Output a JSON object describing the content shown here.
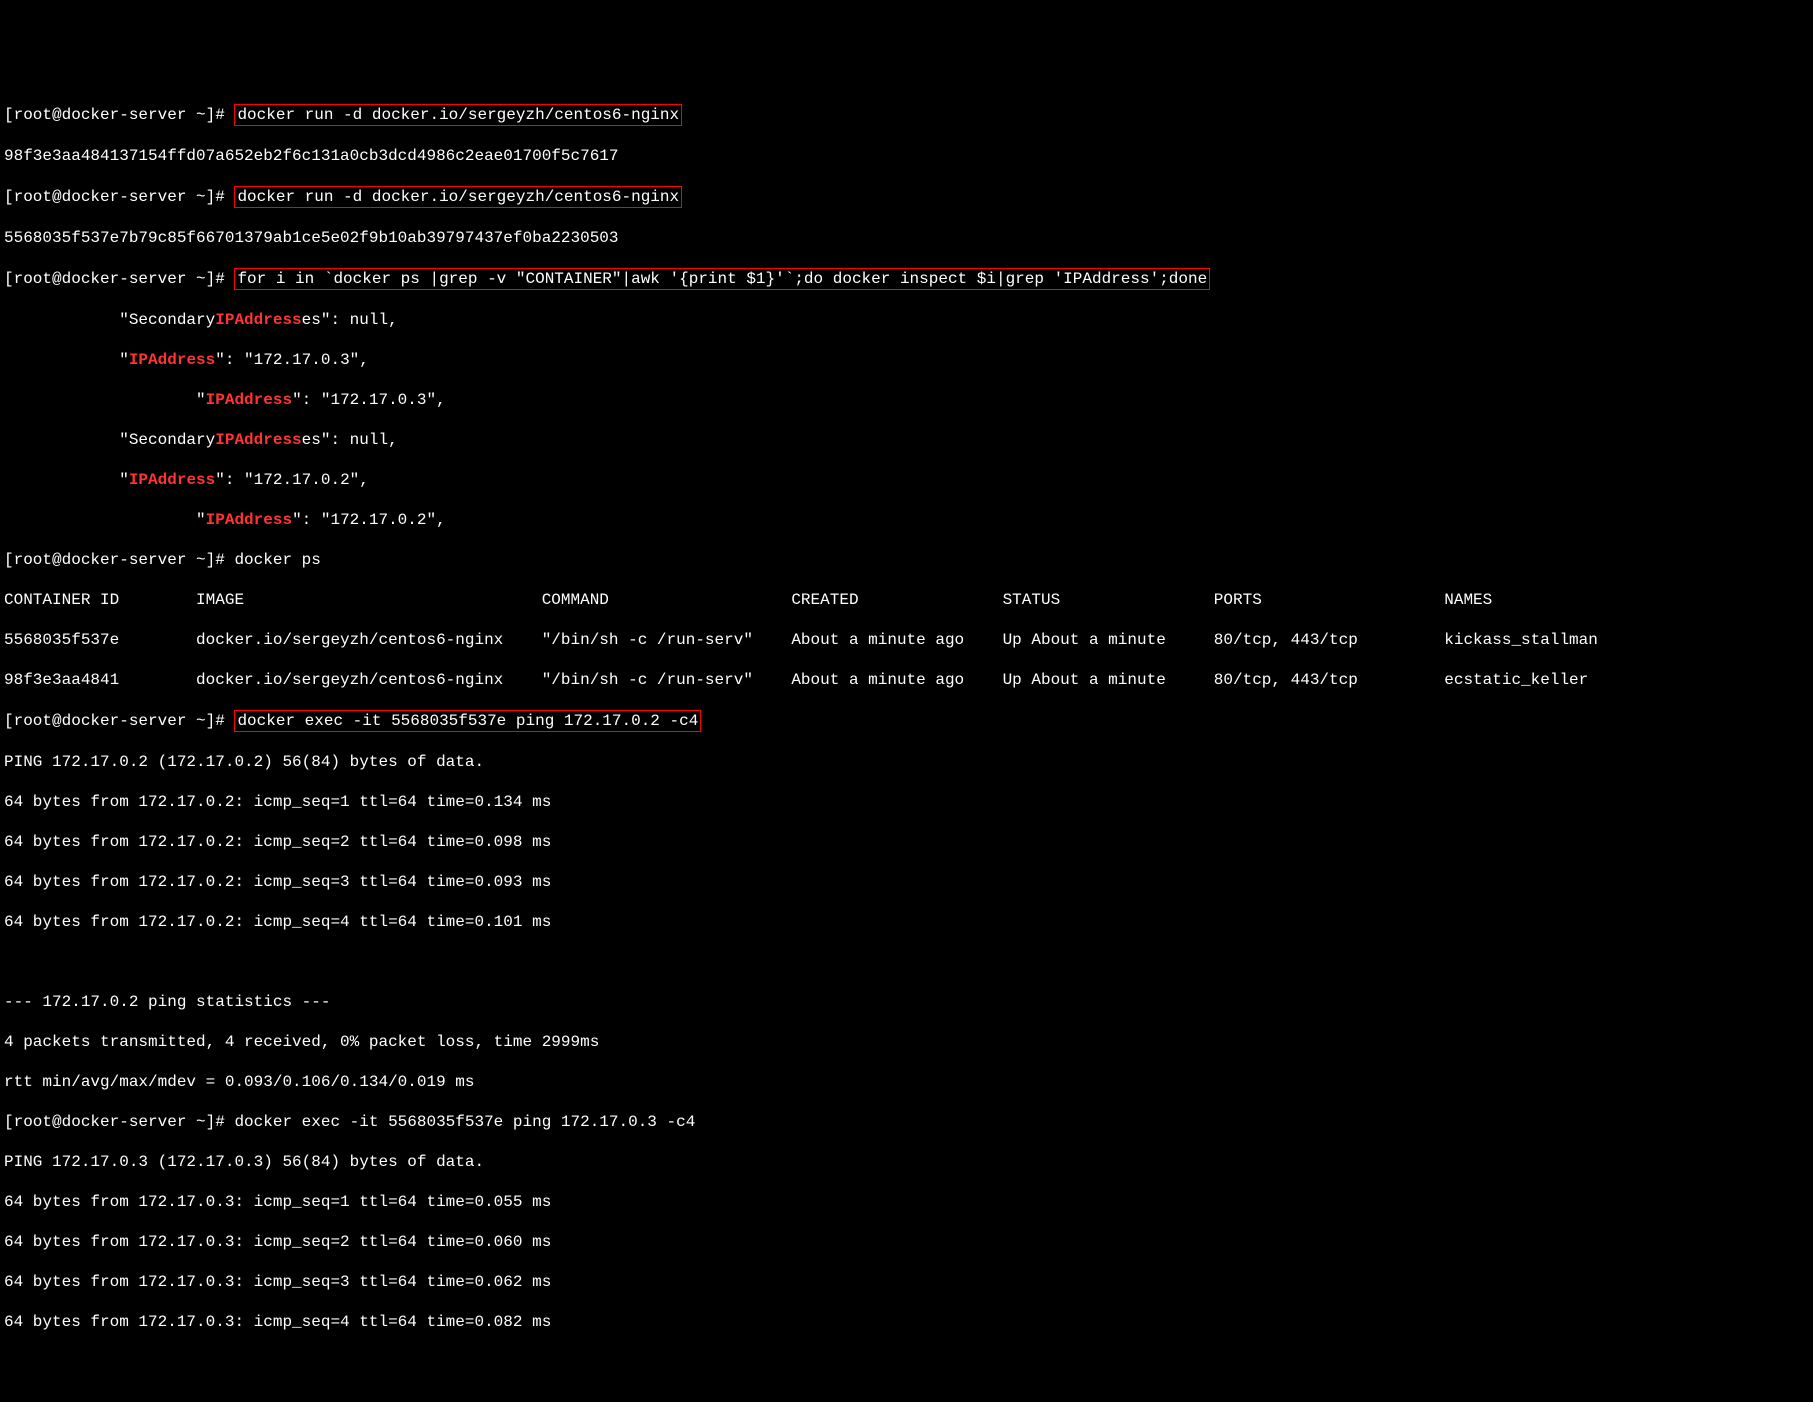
{
  "lines": {
    "prompt1": "[root@docker-server ~]# ",
    "cmd1": "docker run -d docker.io/sergeyzh/centos6-nginx",
    "hash1": "98f3e3aa484137154ffd07a652eb2f6c131a0cb3dcd4986c2eae01700f5c7617",
    "prompt2": "[root@docker-server ~]# ",
    "cmd2": "docker run -d docker.io/sergeyzh/centos6-nginx",
    "hash2": "5568035f537e7b79c85f66701379ab1ce5e02f9b10ab39797437ef0ba2230503",
    "prompt3": "[root@docker-server ~]# ",
    "cmd3": "for i in `docker ps |grep -v \"CONTAINER\"|awk '{print $1}'`;do docker inspect $i|grep 'IPAddress';done",
    "ip_lines": {
      "sec1_pre": "\"Secondary",
      "ipaddr_word": "IPAddress",
      "sec1_post": "es\": null,",
      "ip1_pre": "\"",
      "ip1_post": "\": \"172.17.0.3\",",
      "ip2_pre": "\"",
      "ip2_post": "\": \"172.17.0.3\",",
      "sec2_pre": "\"Secondary",
      "sec2_post": "es\": null,",
      "ip3_pre": "\"",
      "ip3_post": "\": \"172.17.0.2\",",
      "ip4_pre": "\"",
      "ip4_post": "\": \"172.17.0.2\","
    },
    "prompt4": "[root@docker-server ~]# ",
    "cmd4": "docker ps",
    "ps_header": {
      "id": "CONTAINER ID",
      "image": "IMAGE",
      "command": "COMMAND",
      "created": "CREATED",
      "status": "STATUS",
      "ports": "PORTS",
      "names": "NAMES"
    },
    "ps_rows": [
      {
        "id": "5568035f537e",
        "image": "docker.io/sergeyzh/centos6-nginx",
        "command": "\"/bin/sh -c /run-serv\"",
        "created": "About a minute ago",
        "status": "Up About a minute",
        "ports": "80/tcp, 443/tcp",
        "names": "kickass_stallman"
      },
      {
        "id": "98f3e3aa4841",
        "image": "docker.io/sergeyzh/centos6-nginx",
        "command": "\"/bin/sh -c /run-serv\"",
        "created": "About a minute ago",
        "status": "Up About a minute",
        "ports": "80/tcp, 443/tcp",
        "names": "ecstatic_keller"
      }
    ],
    "prompt5": "[root@docker-server ~]# ",
    "cmd5": "docker exec -it 5568035f537e ping 172.17.0.2 -c4",
    "ping1_header": "PING 172.17.0.2 (172.17.0.2) 56(84) bytes of data.",
    "ping1_l1": "64 bytes from 172.17.0.2: icmp_seq=1 ttl=64 time=0.134 ms",
    "ping1_l2": "64 bytes from 172.17.0.2: icmp_seq=2 ttl=64 time=0.098 ms",
    "ping1_l3": "64 bytes from 172.17.0.2: icmp_seq=3 ttl=64 time=0.093 ms",
    "ping1_l4": "64 bytes from 172.17.0.2: icmp_seq=4 ttl=64 time=0.101 ms",
    "blank": " ",
    "ping1_stats": "--- 172.17.0.2 ping statistics ---",
    "ping1_summary1": "4 packets transmitted, 4 received, 0% packet loss, time 2999ms",
    "ping1_summary2": "rtt min/avg/max/mdev = 0.093/0.106/0.134/0.019 ms",
    "prompt6": "[root@docker-server ~]# ",
    "cmd6": "docker exec -it 5568035f537e ping 172.17.0.3 -c4",
    "ping2_header": "PING 172.17.0.3 (172.17.0.3) 56(84) bytes of data.",
    "ping2_l1": "64 bytes from 172.17.0.3: icmp_seq=1 ttl=64 time=0.055 ms",
    "ping2_l2": "64 bytes from 172.17.0.3: icmp_seq=2 ttl=64 time=0.060 ms",
    "ping2_l3": "64 bytes from 172.17.0.3: icmp_seq=3 ttl=64 time=0.062 ms",
    "ping2_l4": "64 bytes from 172.17.0.3: icmp_seq=4 ttl=64 time=0.082 ms"
  }
}
